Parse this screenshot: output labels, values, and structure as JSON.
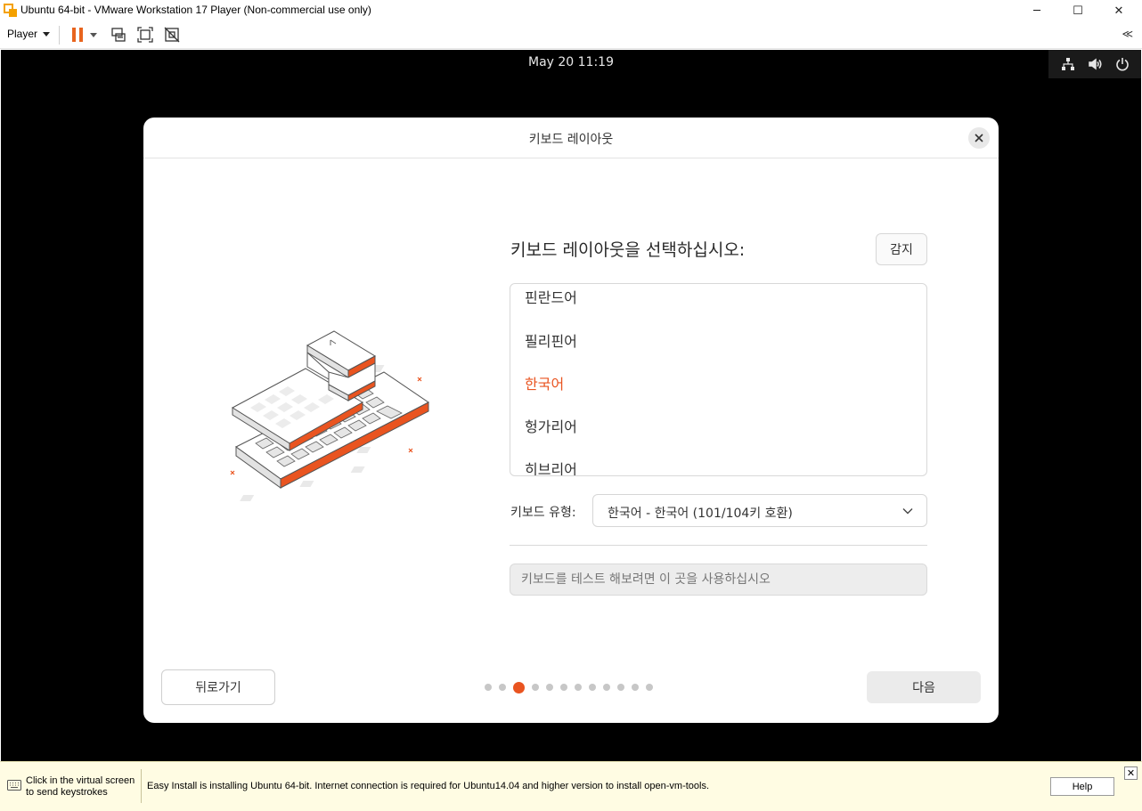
{
  "window": {
    "title": "Ubuntu 64-bit - VMware Workstation 17 Player (Non-commercial use only)",
    "minimize": "─",
    "maximize": "☐",
    "close": "✕"
  },
  "toolbar": {
    "player_menu": "Player",
    "collapse": "≪"
  },
  "guest": {
    "clock": "May 20  11:19"
  },
  "dialog": {
    "title": "키보드 레이아웃",
    "prompt": "키보드 레이아웃을 선택하십시오:",
    "detect_button": "감지",
    "layouts": [
      {
        "label": "핀란드어",
        "selected": false
      },
      {
        "label": "필리핀어",
        "selected": false
      },
      {
        "label": "한국어",
        "selected": true
      },
      {
        "label": "헝가리어",
        "selected": false
      },
      {
        "label": "히브리어",
        "selected": false
      }
    ],
    "keyboard_type_label": "키보드 유형:",
    "keyboard_type_value": "한국어 - 한국어 (101/104키 호환)",
    "test_placeholder": "키보드를 테스트 해보려면 이 곳을 사용하십시오",
    "back_button": "뒤로가기",
    "next_button": "다음",
    "steps": {
      "total": 12,
      "current": 3
    }
  },
  "hint_bar": {
    "click_hint_line1": "Click in the virtual screen",
    "click_hint_line2": "to send keystrokes",
    "message": "Easy Install is installing Ubuntu 64-bit. Internet connection is required for Ubuntu14.04 and higher version to install open-vm-tools.",
    "help_button": "Help",
    "close": "✕"
  },
  "colors": {
    "accent": "#e95420",
    "vmware_orange": "#f4a100"
  }
}
